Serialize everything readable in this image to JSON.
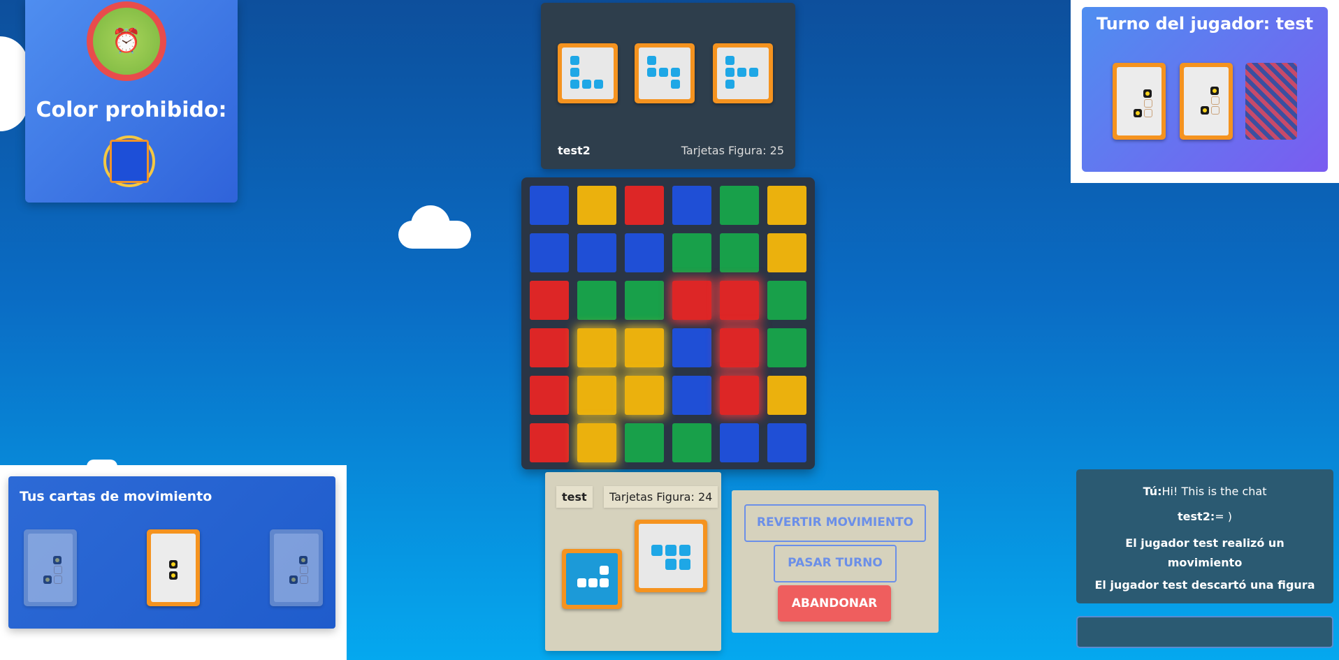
{
  "timer": {
    "icon": "alarm-clock-icon",
    "glyph": "⏰"
  },
  "forbidden": {
    "label": "Color prohibido:",
    "color": "#1d4fd8"
  },
  "opponent": {
    "name": "test2",
    "figure_count": "Tarjetas Figura: 25"
  },
  "board": {
    "rows": [
      [
        "blue",
        "yellow",
        "red",
        "blue",
        "green",
        "yellow"
      ],
      [
        "blue",
        "blue",
        "blue",
        "green",
        "green",
        "yellow"
      ],
      [
        "red",
        "green",
        "green",
        "red",
        "red",
        "green"
      ],
      [
        "red",
        "yellow",
        "yellow",
        "blue",
        "red",
        "green"
      ],
      [
        "red",
        "yellow",
        "yellow",
        "blue",
        "red",
        "yellow"
      ],
      [
        "red",
        "yellow",
        "green",
        "green",
        "blue",
        "blue"
      ]
    ],
    "colors": {
      "blue": "#1f4fd6",
      "yellow": "#ebb10d",
      "red": "#dd2626",
      "green": "#18a04a"
    }
  },
  "turn": {
    "title": "Turno del jugador: test"
  },
  "hand": {
    "title": "Tus cartas de movimiento"
  },
  "me": {
    "name": "test",
    "figure_count": "Tarjetas Figura: 24"
  },
  "actions": {
    "revert": "REVERTIR MOVIMIENTO",
    "pass": "PASAR TURNO",
    "abandon": "ABANDONAR"
  },
  "chat": {
    "messages": [
      {
        "author": "Tú:",
        "text": "Hi! This is the chat"
      },
      {
        "author": "test2:",
        "text": "= )"
      }
    ],
    "events": [
      "El jugador test realizó un movimiento",
      "El jugador test descartó una figura"
    ]
  }
}
